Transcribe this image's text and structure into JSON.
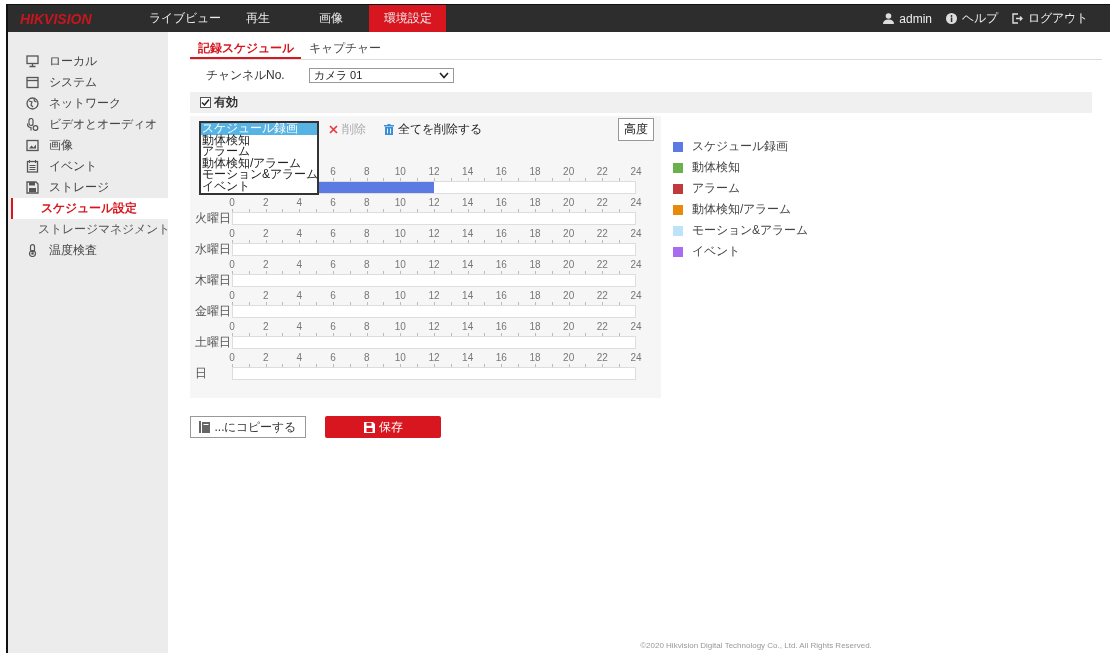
{
  "header": {
    "logo": "HIKVISION",
    "nav": [
      {
        "label": "ライブビュー",
        "selected": false
      },
      {
        "label": "再生",
        "selected": false
      },
      {
        "label": "画像",
        "selected": false
      },
      {
        "label": "環境設定",
        "selected": true
      }
    ],
    "user": "admin",
    "help": "ヘルプ",
    "logout": "ログアウト"
  },
  "sidebar": {
    "items": [
      {
        "label": "ローカル",
        "selected": false
      },
      {
        "label": "システム",
        "selected": false
      },
      {
        "label": "ネットワーク",
        "selected": false
      },
      {
        "label": "ビデオとオーディオ",
        "selected": false
      },
      {
        "label": "画像",
        "selected": false
      },
      {
        "label": "イベント",
        "selected": false
      },
      {
        "label": "ストレージ",
        "selected": false,
        "children": [
          {
            "label": "スケジュール設定",
            "selected": true
          },
          {
            "label": "ストレージマネジメント",
            "selected": false
          }
        ]
      },
      {
        "label": "温度検査",
        "selected": false
      }
    ]
  },
  "tabs": [
    {
      "label": "記録スケジュール",
      "selected": true
    },
    {
      "label": "キャプチャー",
      "selected": false
    }
  ],
  "channel": {
    "label": "チャンネルNo.",
    "value": "カメラ 01"
  },
  "enable": {
    "label": "有効",
    "checked": true
  },
  "type_list": [
    {
      "label": "スケジュール録画",
      "selected": true
    },
    {
      "label": "動体検知",
      "selected": false
    },
    {
      "label": "アラーム",
      "selected": false
    },
    {
      "label": "動体検知/アラーム",
      "selected": false
    },
    {
      "label": "モーション&アラーム",
      "selected": false
    },
    {
      "label": "イベント",
      "selected": false
    }
  ],
  "toolbar": {
    "delete": "削除",
    "delete_disabled": true,
    "delete_all": "全てを削除する",
    "advanced": "高度"
  },
  "days": [
    {
      "ticks": [
        "6",
        "8",
        "10",
        "12",
        "14",
        "16",
        "18",
        "20",
        "22",
        "24"
      ],
      "level": 0.5,
      "color": "#5b7be3"
    },
    {
      "label": "火曜日",
      "ticks": [
        "0",
        "2",
        "4",
        "6",
        "8",
        "10",
        "12",
        "14",
        "16",
        "18",
        "20",
        "22",
        "24"
      ]
    },
    {
      "label": "水曜日",
      "ticks": [
        "0",
        "2",
        "4",
        "6",
        "8",
        "10",
        "12",
        "14",
        "16",
        "18",
        "20",
        "22",
        "24"
      ]
    },
    {
      "label": "木曜日",
      "ticks": [
        "0",
        "2",
        "4",
        "6",
        "8",
        "10",
        "12",
        "14",
        "16",
        "18",
        "20",
        "22",
        "24"
      ]
    },
    {
      "label": "金曜日",
      "ticks": [
        "0",
        "2",
        "4",
        "6",
        "8",
        "10",
        "12",
        "14",
        "16",
        "18",
        "20",
        "22",
        "24"
      ]
    },
    {
      "label": "土曜日",
      "ticks": [
        "0",
        "2",
        "4",
        "6",
        "8",
        "10",
        "12",
        "14",
        "16",
        "18",
        "20",
        "22",
        "24"
      ]
    },
    {
      "label": "日",
      "ticks": [
        "0",
        "2",
        "4",
        "6",
        "8",
        "10",
        "12",
        "14",
        "16",
        "18",
        "20",
        "22",
        "24"
      ]
    }
  ],
  "legend": [
    {
      "label": "スケジュール録画",
      "color": "#5b7be3"
    },
    {
      "label": "動体検知",
      "color": "#6ab04c"
    },
    {
      "label": "アラーム",
      "color": "#c0393b"
    },
    {
      "label": "動体検知/アラーム",
      "color": "#e8890c"
    },
    {
      "label": "モーション&アラーム",
      "color": "#bde3fa"
    },
    {
      "label": "イベント",
      "color": "#a86cf0"
    }
  ],
  "buttons": {
    "copy": "...にコピーする",
    "save": "保存"
  },
  "footer": "©2020 Hikvision Digital Technology Co., Ltd. All Rights Reserved."
}
